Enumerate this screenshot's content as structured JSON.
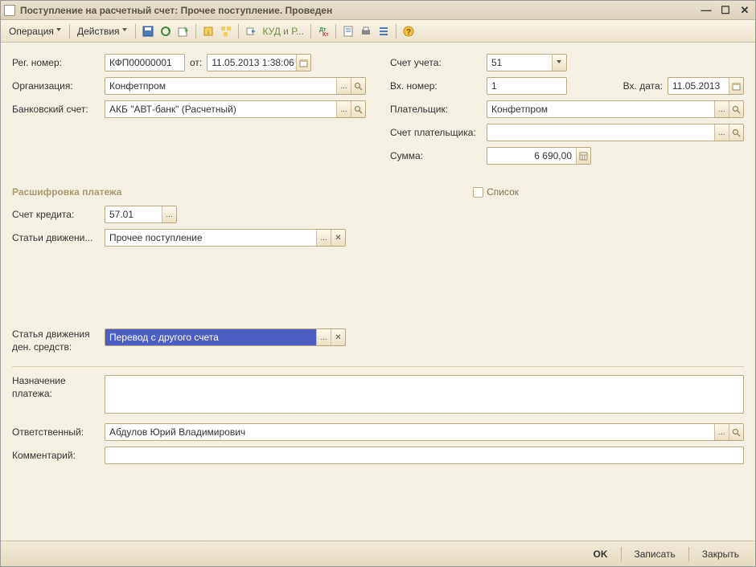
{
  "window": {
    "title": "Поступление на расчетный счет: Прочее поступление. Проведен"
  },
  "menu": {
    "operation": "Операция",
    "actions": "Действия",
    "kudir": "КУД и Р..."
  },
  "labels": {
    "reg_no": "Рег. номер:",
    "from": "от:",
    "org": "Организация:",
    "bank_acc": "Банковский счет:",
    "acc": "Счет учета:",
    "in_no": "Вх. номер:",
    "in_date": "Вх. дата:",
    "payer": "Плательщик:",
    "payer_acc": "Счет плательщика:",
    "sum": "Сумма:",
    "list": "Список",
    "section": "Расшифровка платежа",
    "credit_acc": "Счет кредита:",
    "move_article": "Статьи движени...",
    "cash_article": "Статья движения ден. средств:",
    "purpose": "Назначение платежа:",
    "responsible": "Ответственный:",
    "comment": "Комментарий:"
  },
  "values": {
    "reg_no": "КФП00000001",
    "date": "11.05.2013 1:38:06",
    "org": "Конфетпром",
    "bank_acc": "АКБ \"АВТ-банк\" (Расчетный)",
    "acc": "51",
    "in_no": "1",
    "in_date": "11.05.2013",
    "payer": "Конфетпром",
    "payer_acc": "",
    "sum": "6 690,00",
    "credit_acc": "57.01",
    "move_article": "Прочее поступление",
    "cash_article": "Перевод с другого счета",
    "responsible": "Абдулов Юрий Владимирович",
    "comment": ""
  },
  "footer": {
    "ok": "OK",
    "save": "Записать",
    "close": "Закрыть"
  }
}
